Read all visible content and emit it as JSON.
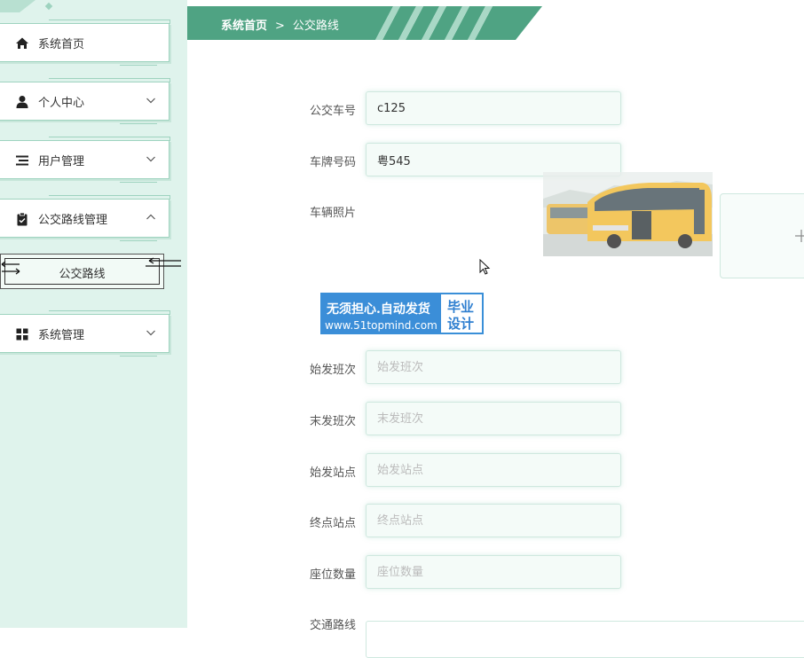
{
  "sidebar": {
    "items": [
      {
        "label": "系统首页",
        "icon": "home-icon",
        "expanded": null
      },
      {
        "label": "个人中心",
        "icon": "user-icon",
        "expanded": false
      },
      {
        "label": "用户管理",
        "icon": "list-icon",
        "expanded": false
      },
      {
        "label": "公交路线管理",
        "icon": "clipboard-icon",
        "expanded": true
      },
      {
        "label": "系统管理",
        "icon": "grid-icon",
        "expanded": false
      }
    ],
    "submenu": {
      "label": "公交路线"
    }
  },
  "breadcrumb": {
    "home": "系统首页",
    "separator": ">",
    "current": "公交路线"
  },
  "form": {
    "bus_number": {
      "label": "公交车号",
      "value": "c125",
      "placeholder": ""
    },
    "plate_number": {
      "label": "车牌号码",
      "value": "粤545",
      "placeholder": ""
    },
    "vehicle_photo": {
      "label": "车辆照片"
    },
    "first_trip": {
      "label": "始发班次",
      "value": "",
      "placeholder": "始发班次"
    },
    "last_trip": {
      "label": "末发班次",
      "value": "",
      "placeholder": "末发班次"
    },
    "start_station": {
      "label": "始发站点",
      "value": "",
      "placeholder": "始发站点"
    },
    "end_station": {
      "label": "终点站点",
      "value": "",
      "placeholder": "终点站点"
    },
    "seat_count": {
      "label": "座位数量",
      "value": "",
      "placeholder": "座位数量"
    },
    "route": {
      "label": "交通路线"
    }
  },
  "watermark": {
    "line1": "无须担心.自动发货",
    "line2": "www.51topmind.com",
    "right1": "毕业",
    "right2": "设计"
  },
  "colors": {
    "accent": "#4fa383",
    "sidebar_bg": "#dff3ec",
    "border": "#9ed3bf",
    "watermark_blue": "#3b8ed8"
  }
}
